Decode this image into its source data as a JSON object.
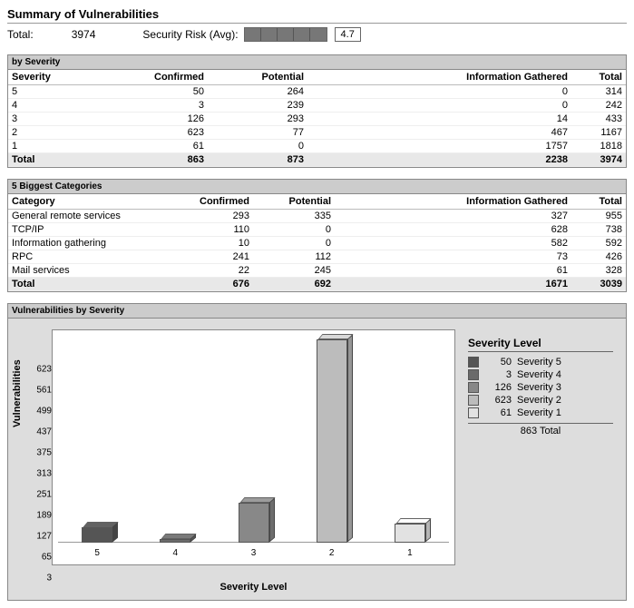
{
  "title": "Summary of Vulnerabilities",
  "summary": {
    "total_label": "Total:",
    "total_value": "3974",
    "risk_label": "Security Risk (Avg):",
    "risk_value": "4.7"
  },
  "severity_table": {
    "header": "by Severity",
    "columns": {
      "c0": "Severity",
      "c1": "Confirmed",
      "c2": "Potential",
      "c3": "Information Gathered",
      "c4": "Total"
    },
    "rows": [
      {
        "sev": "5",
        "conf": "50",
        "pot": "264",
        "info": "0",
        "tot": "314"
      },
      {
        "sev": "4",
        "conf": "3",
        "pot": "239",
        "info": "0",
        "tot": "242"
      },
      {
        "sev": "3",
        "conf": "126",
        "pot": "293",
        "info": "14",
        "tot": "433"
      },
      {
        "sev": "2",
        "conf": "623",
        "pot": "77",
        "info": "467",
        "tot": "1167"
      },
      {
        "sev": "1",
        "conf": "61",
        "pot": "0",
        "info": "1757",
        "tot": "1818"
      }
    ],
    "total": {
      "label": "Total",
      "conf": "863",
      "pot": "873",
      "info": "2238",
      "tot": "3974"
    }
  },
  "category_table": {
    "header": "5 Biggest Categories",
    "columns": {
      "c0": "Category",
      "c1": "Confirmed",
      "c2": "Potential",
      "c3": "Information Gathered",
      "c4": "Total"
    },
    "rows": [
      {
        "cat": "General remote services",
        "conf": "293",
        "pot": "335",
        "info": "327",
        "tot": "955"
      },
      {
        "cat": "TCP/IP",
        "conf": "110",
        "pot": "0",
        "info": "628",
        "tot": "738"
      },
      {
        "cat": "Information gathering",
        "conf": "10",
        "pot": "0",
        "info": "582",
        "tot": "592"
      },
      {
        "cat": "RPC",
        "conf": "241",
        "pot": "112",
        "info": "73",
        "tot": "426"
      },
      {
        "cat": "Mail services",
        "conf": "22",
        "pot": "245",
        "info": "61",
        "tot": "328"
      }
    ],
    "total": {
      "label": "Total",
      "conf": "676",
      "pot": "692",
      "info": "1671",
      "tot": "3039"
    }
  },
  "chart_section_header": "Vulnerabilities by Severity",
  "chart": {
    "ylabel": "Vulnerabilities",
    "xlabel": "Severity Level",
    "yticks": [
      "623",
      "561",
      "499",
      "437",
      "375",
      "313",
      "251",
      "189",
      "127",
      "65",
      "3"
    ],
    "xticks": [
      "5",
      "4",
      "3",
      "2",
      "1"
    ],
    "legend_title": "Severity Level",
    "legend": [
      {
        "count": "50",
        "label": "Severity 5",
        "color": "#555"
      },
      {
        "count": "3",
        "label": "Severity 4",
        "color": "#6a6a6a"
      },
      {
        "count": "126",
        "label": "Severity 3",
        "color": "#888"
      },
      {
        "count": "623",
        "label": "Severity 2",
        "color": "#bcbcbc"
      },
      {
        "count": "61",
        "label": "Severity 1",
        "color": "#e2e2e2"
      }
    ],
    "legend_total": "863 Total"
  },
  "chart_data": {
    "type": "bar",
    "title": "Vulnerabilities by Severity",
    "xlabel": "Severity Level",
    "ylabel": "Vulnerabilities",
    "categories": [
      "5",
      "4",
      "3",
      "2",
      "1"
    ],
    "values": [
      50,
      3,
      126,
      623,
      61
    ],
    "ylim": [
      3,
      623
    ],
    "colors": [
      "#555",
      "#6a6a6a",
      "#888",
      "#bcbcbc",
      "#e2e2e2"
    ],
    "legend": [
      "Severity 5",
      "Severity 4",
      "Severity 3",
      "Severity 2",
      "Severity 1"
    ],
    "total": 863
  }
}
